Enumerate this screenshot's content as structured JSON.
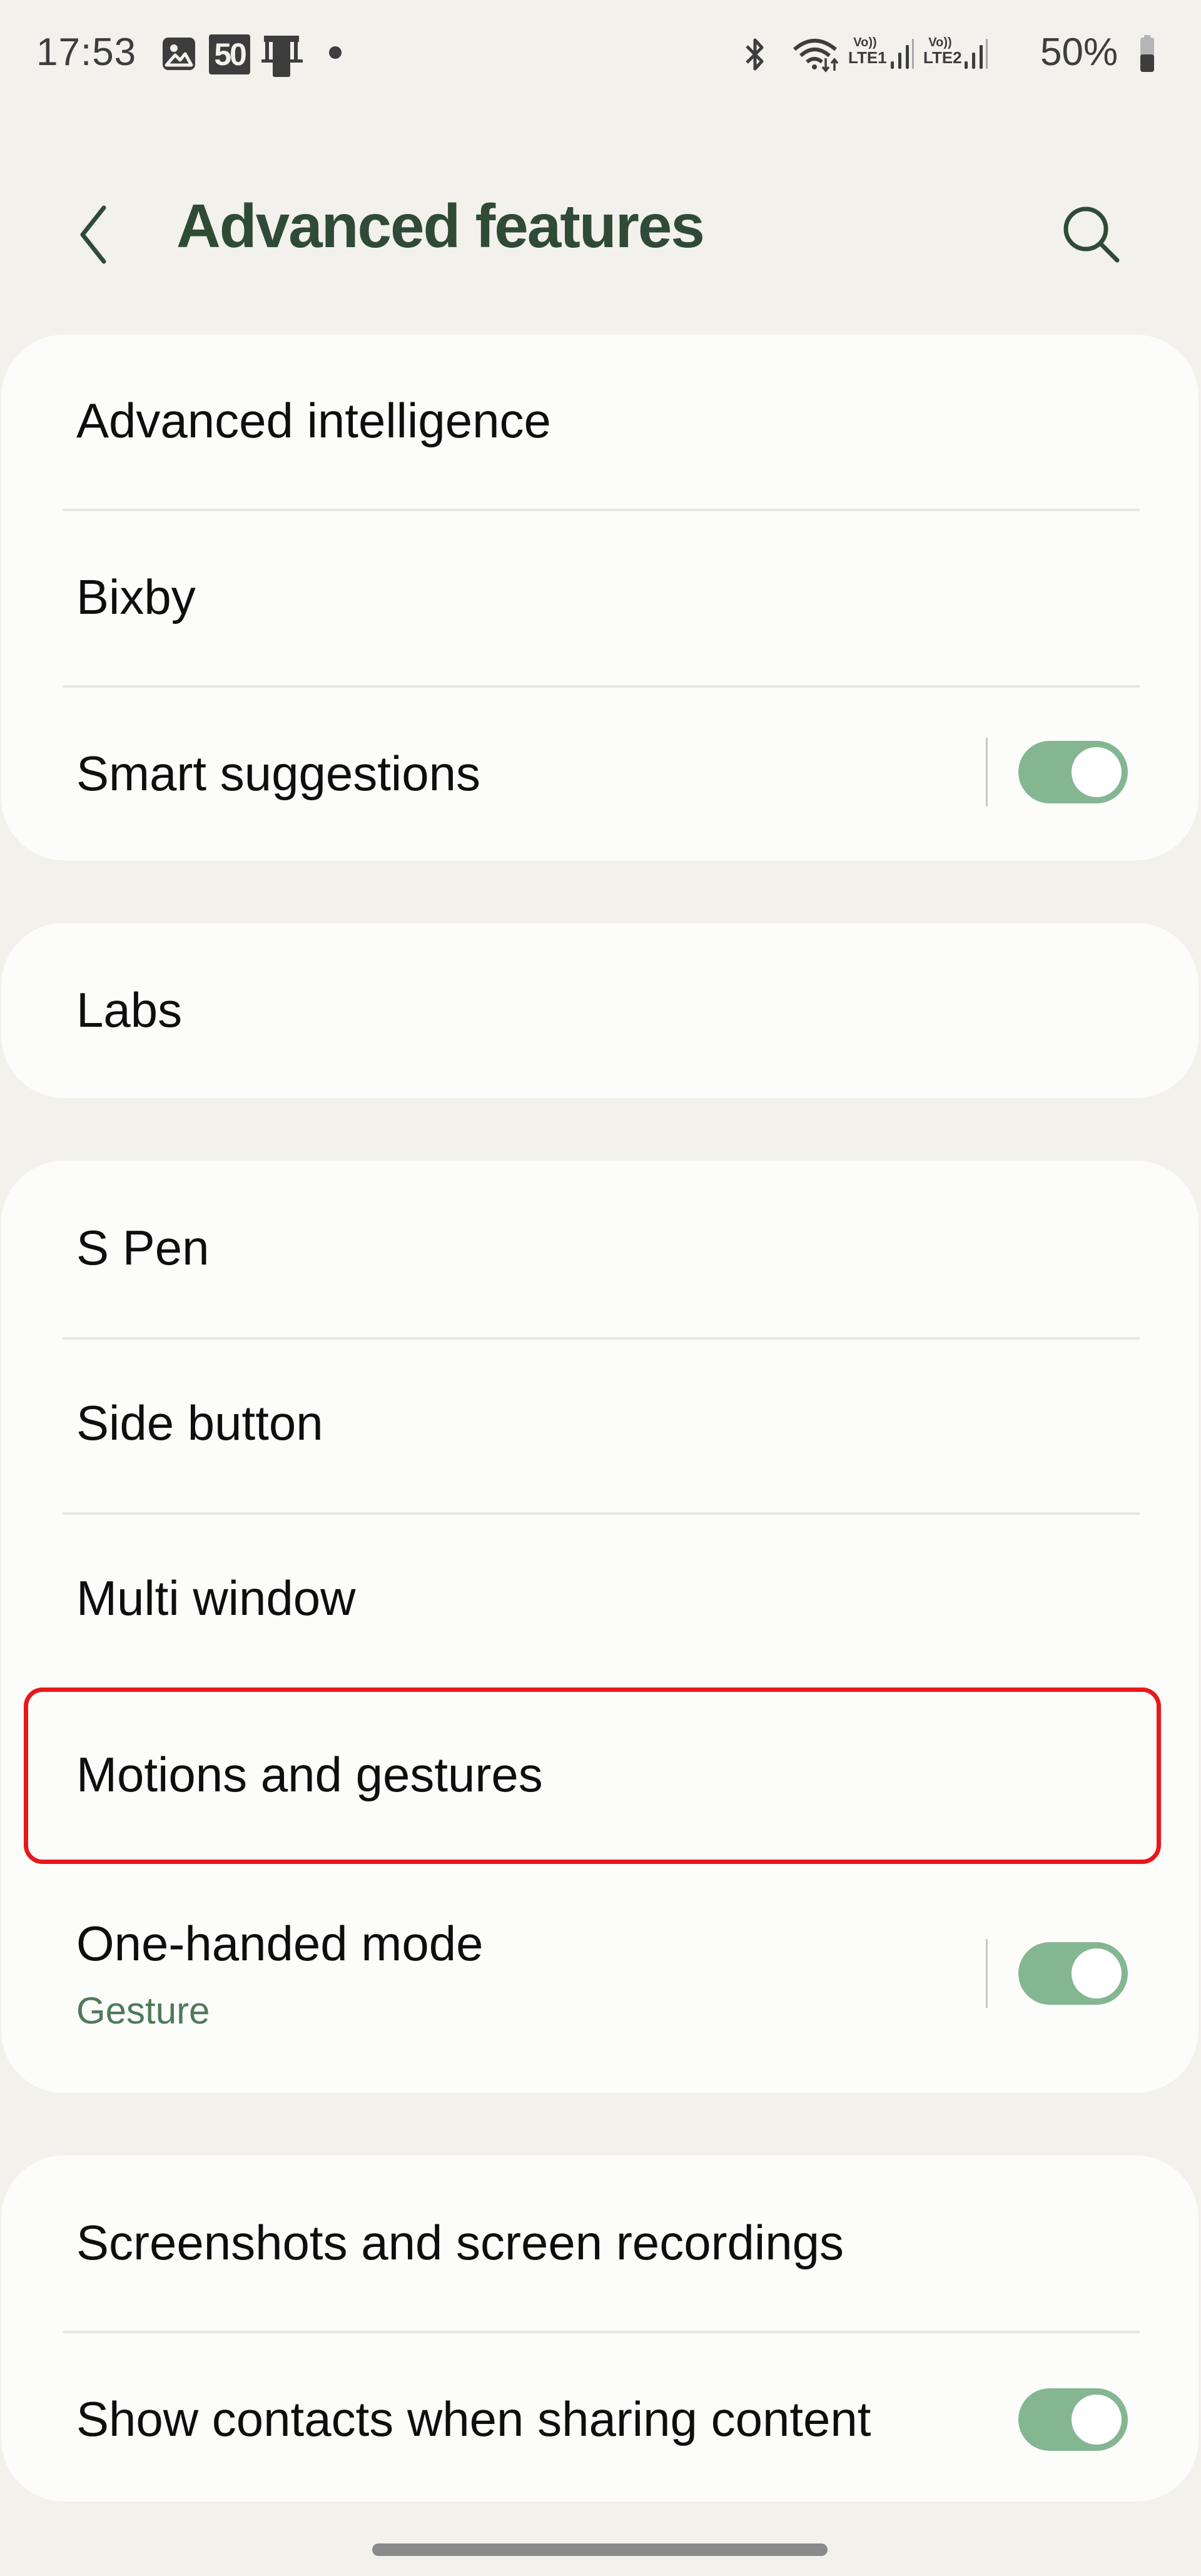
{
  "status_bar": {
    "time": "17:53",
    "left_icons": [
      "gallery-icon",
      "speed-50-icon",
      "phone-stand-icon",
      "notification-dot-icon"
    ],
    "speed_badge": "50",
    "right_icons": [
      "bluetooth-icon",
      "wifi-icon",
      "sim1-signal-icon",
      "sim2-signal-icon",
      "battery-icon"
    ],
    "sim1_top": "Vo))",
    "sim1_bottom": "LTE1",
    "sim2_top": "Vo))",
    "sim2_bottom": "LTE2",
    "battery_percent": "50%",
    "battery_level": 0.5
  },
  "header": {
    "title": "Advanced features",
    "back_icon": "chevron-left-icon",
    "search_icon": "search-icon"
  },
  "colors": {
    "background": "#f2f1ec",
    "card": "#fcfcfb",
    "title_green": "#2f4b36",
    "subtitle_green": "#4f7a5a",
    "toggle_on": "#84b692",
    "highlight_red": "#e8181a"
  },
  "groups": [
    {
      "items": [
        {
          "label": "Advanced intelligence"
        },
        {
          "label": "Bixby"
        },
        {
          "label": "Smart suggestions",
          "toggle": true
        }
      ]
    },
    {
      "items": [
        {
          "label": "Labs"
        }
      ]
    },
    {
      "items": [
        {
          "label": "S Pen"
        },
        {
          "label": "Side button"
        },
        {
          "label": "Multi window"
        },
        {
          "label": "Motions and gestures",
          "highlighted": true
        },
        {
          "label": "One-handed mode",
          "sublabel": "Gesture",
          "toggle": true
        }
      ]
    },
    {
      "items": [
        {
          "label": "Screenshots and screen recordings"
        },
        {
          "label": "Show contacts when sharing content",
          "toggle": true
        }
      ]
    }
  ]
}
